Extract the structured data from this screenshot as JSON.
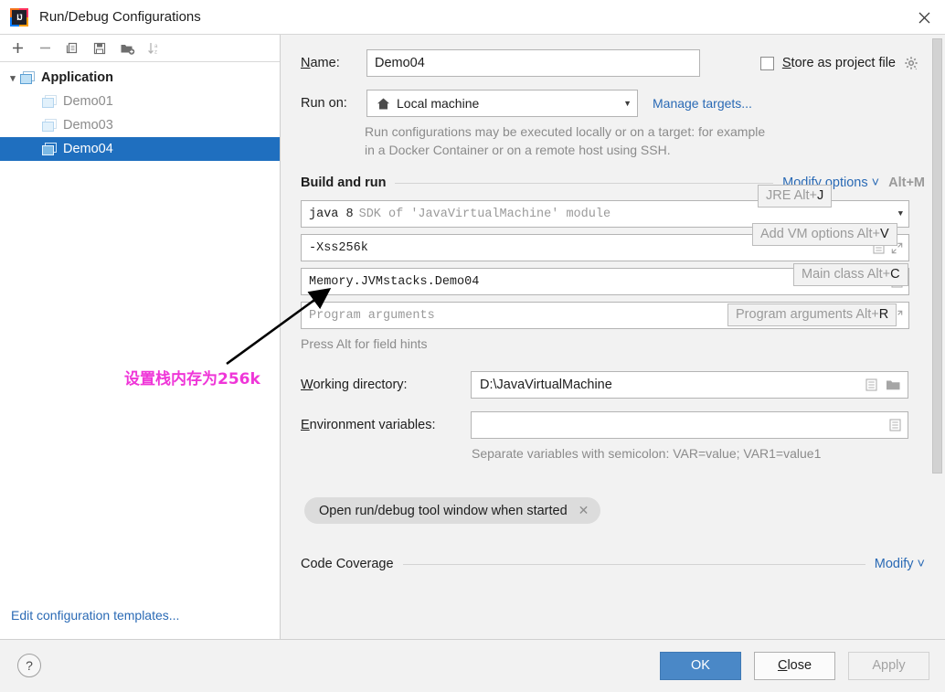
{
  "window": {
    "title": "Run/Debug Configurations",
    "logo_text": "IJ",
    "close_icon": "close-icon"
  },
  "sidebar": {
    "toolbar": [
      {
        "name": "add-configuration-button",
        "glyph": "+"
      },
      {
        "name": "remove-configuration-button",
        "glyph": "−"
      },
      {
        "name": "copy-configuration-button",
        "glyph": "copy-icon"
      },
      {
        "name": "save-configuration-button",
        "glyph": "save-icon"
      },
      {
        "name": "move-to-folder-button",
        "glyph": "folder-add-icon"
      },
      {
        "name": "sort-configurations-button",
        "glyph": "sort-az-icon"
      }
    ],
    "tree": [
      {
        "label": "Application",
        "type": "group",
        "expanded": true,
        "selected": false
      },
      {
        "label": "Demo01",
        "type": "item",
        "muted": true,
        "selected": false
      },
      {
        "label": "Demo03",
        "type": "item",
        "muted": true,
        "selected": false
      },
      {
        "label": "Demo04",
        "type": "item",
        "muted": false,
        "selected": true
      }
    ],
    "edit_templates_link": "Edit configuration templates..."
  },
  "form": {
    "name_label": "Name:",
    "name_label_accel": "N",
    "name_value": "Demo04",
    "store_as_project_file_label": "Store as project file",
    "store_as_project_file_accel": "S",
    "store_as_project_file_checked": false,
    "gear_icon": "gear-icon",
    "run_on_label": "Run on:",
    "run_on_value": "Local machine",
    "run_on_icon": "home-icon",
    "manage_targets_link": "Manage targets...",
    "run_on_description": "Run configurations may be executed locally or on a target: for example in a Docker Container or on a remote host using SSH.",
    "build_and_run_title": "Build and run",
    "modify_options_link": "Modify options",
    "modify_options_shortcut": "Alt+M",
    "jre_value_bold": "java 8",
    "jre_value_rest": "SDK of 'JavaVirtualMachine' module",
    "vm_options_value": "-Xss256k",
    "main_class_value": "Memory.JVMstacks.Demo04",
    "program_arguments_placeholder": "Program arguments",
    "press_alt_hint": "Press Alt for field hints",
    "hints": [
      {
        "name": "hint-jre",
        "text": "JRE Alt+",
        "key": "J"
      },
      {
        "name": "hint-vm-options",
        "text": "Add VM options Alt+",
        "key": "V"
      },
      {
        "name": "hint-main-class",
        "text": "Main class Alt+",
        "key": "C"
      },
      {
        "name": "hint-program-arguments",
        "text": "Program arguments Alt+",
        "key": "R"
      }
    ],
    "working_directory_label": "Working directory:",
    "working_directory_accel": "W",
    "working_directory_value": "D:\\JavaVirtualMachine",
    "environment_variables_label": "Environment variables:",
    "environment_variables_accel": "E",
    "environment_variables_value": "",
    "environment_note": "Separate variables with semicolon: VAR=value; VAR1=value1",
    "open_tool_window_chip": "Open run/debug tool window when started",
    "chip_close_icon": "close-icon",
    "code_coverage_title": "Code Coverage",
    "code_coverage_modify_link": "Modify"
  },
  "annotation": {
    "text": "设置栈内存为256k",
    "color": "#ef36d8"
  },
  "footer": {
    "help_label": "?",
    "ok_label": "OK",
    "close_label": "Close",
    "close_accel": "C",
    "apply_label": "Apply",
    "apply_disabled": true
  },
  "colors": {
    "selection_blue": "#1f6fbf",
    "primary_button": "#4a88c7",
    "link_blue": "#2a6ab5",
    "annotation_magenta": "#ef36d8"
  }
}
